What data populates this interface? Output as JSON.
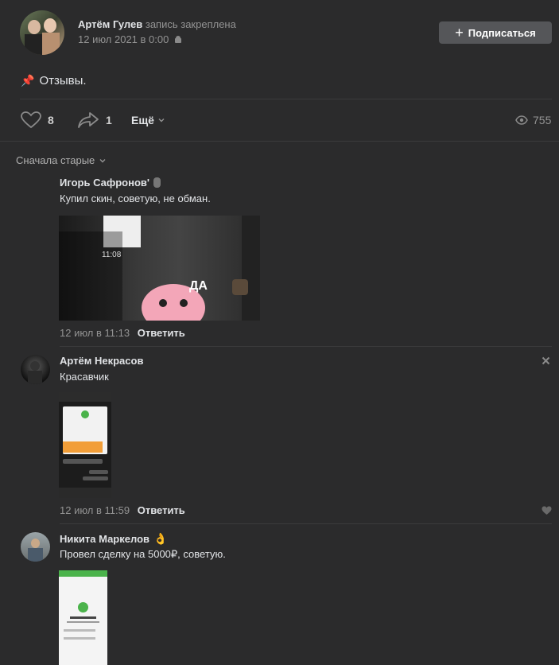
{
  "post": {
    "author": "Артём Гулев",
    "pinned_text": "запись закреплена",
    "date": "12 июл 2021 в 0:00",
    "subscribe_label": "Подписаться",
    "pin_emoji": "📌",
    "text": "Отзывы.",
    "likes": "8",
    "shares": "1",
    "more_label": "Ещё",
    "views": "755"
  },
  "sort_label": "Сначала старые",
  "comments": [
    {
      "author": "Игорь Сафронов'",
      "text": "Купил скин, советую, не обман.",
      "date": "12 июл в 11:13",
      "reply": "Ответить",
      "image_time": "11:08",
      "image_sticker_text": "ДА"
    },
    {
      "author": "Артём Некрасов",
      "text": "Красавчик",
      "date": "12 июл в 11:59",
      "reply": "Ответить"
    },
    {
      "author": "Никита Маркелов",
      "author_emoji": "👌",
      "text": "Провел сделку на 5000₽, советую."
    }
  ],
  "colors": {
    "background": "#2b2b2c",
    "button": "#555659",
    "text": "#e1e3e6",
    "muted": "#939393"
  }
}
